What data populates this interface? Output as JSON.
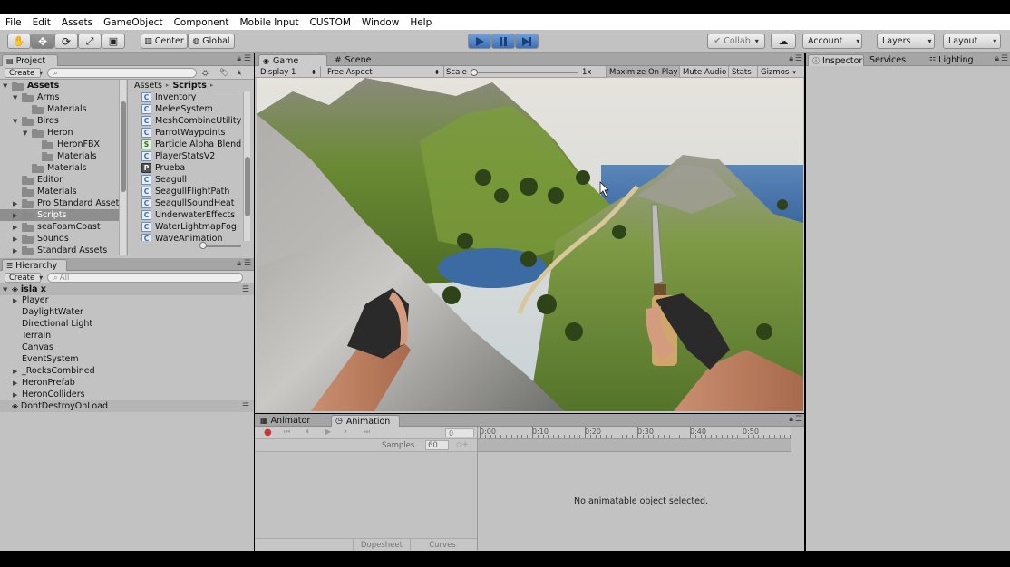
{
  "menubar": [
    "File",
    "Edit",
    "Assets",
    "GameObject",
    "Component",
    "Mobile Input",
    "CUSTOM",
    "Window",
    "Help"
  ],
  "toolbar": {
    "pivot": "Center",
    "space": "Global",
    "collab": "Collab",
    "account": "Account",
    "layers": "Layers",
    "layout": "Layout"
  },
  "project": {
    "tab": "Project",
    "create": "Create",
    "folders": [
      {
        "label": "Assets",
        "level": 0,
        "arrow": "▼",
        "bold": true
      },
      {
        "label": "Arms",
        "level": 1,
        "arrow": "▼"
      },
      {
        "label": "Materials",
        "level": 2,
        "arrow": ""
      },
      {
        "label": "Birds",
        "level": 1,
        "arrow": "▼"
      },
      {
        "label": "Heron",
        "level": 2,
        "arrow": "▼"
      },
      {
        "label": "HeronFBX",
        "level": 3,
        "arrow": ""
      },
      {
        "label": "Materials",
        "level": 3,
        "arrow": ""
      },
      {
        "label": "Materials",
        "level": 2,
        "arrow": ""
      },
      {
        "label": "Editor",
        "level": 1,
        "arrow": ""
      },
      {
        "label": "Materials",
        "level": 1,
        "arrow": ""
      },
      {
        "label": "Pro Standard Asset",
        "level": 1,
        "arrow": "▶"
      },
      {
        "label": "Scripts",
        "level": 1,
        "arrow": "▶",
        "selected": true
      },
      {
        "label": "seaFoamCoast",
        "level": 1,
        "arrow": "▶"
      },
      {
        "label": "Sounds",
        "level": 1,
        "arrow": "▶"
      },
      {
        "label": "Standard Assets",
        "level": 1,
        "arrow": "▶"
      }
    ],
    "breadcrumb": [
      "Assets",
      "Scripts"
    ],
    "files": [
      {
        "label": "Inventory",
        "icon": "C"
      },
      {
        "label": "MeleeSystem",
        "icon": "C"
      },
      {
        "label": "MeshCombineUtility",
        "icon": "C"
      },
      {
        "label": "ParrotWaypoints",
        "icon": "C"
      },
      {
        "label": "Particle Alpha Blend",
        "icon": "S"
      },
      {
        "label": "PlayerStatsV2",
        "icon": "C"
      },
      {
        "label": "Prueba",
        "icon": "P"
      },
      {
        "label": "Seagull",
        "icon": "C"
      },
      {
        "label": "SeagullFlightPath",
        "icon": "C"
      },
      {
        "label": "SeagullSoundHeat",
        "icon": "C"
      },
      {
        "label": "UnderwaterEffects",
        "icon": "C"
      },
      {
        "label": "WaterLightmapFog",
        "icon": "C"
      },
      {
        "label": "WaveAnimation",
        "icon": "C"
      }
    ]
  },
  "hierarchy": {
    "tab": "Hierarchy",
    "create": "Create",
    "search_placeholder": "All",
    "scene": "isla x",
    "items": [
      {
        "label": "Player",
        "arrow": "▶"
      },
      {
        "label": "DaylightWater",
        "arrow": ""
      },
      {
        "label": "Directional Light",
        "arrow": ""
      },
      {
        "label": "Terrain",
        "arrow": ""
      },
      {
        "label": "Canvas",
        "arrow": ""
      },
      {
        "label": "EventSystem",
        "arrow": ""
      },
      {
        "label": "_RocksCombined",
        "arrow": "▶"
      },
      {
        "label": "HeronPrefab",
        "arrow": "▶"
      },
      {
        "label": "HeronColliders",
        "arrow": "▶"
      }
    ],
    "dontdestroy": "DontDestroyOnLoad"
  },
  "game": {
    "tabs": [
      "Game",
      "Scene"
    ],
    "display": "Display 1",
    "aspect": "Free Aspect",
    "scale_label": "Scale",
    "scale_value": "1x",
    "toggles": [
      "Maximize On Play",
      "Mute Audio",
      "Stats",
      "Gizmos"
    ]
  },
  "animation": {
    "tabs": [
      "Animator",
      "Animation"
    ],
    "frame": "0",
    "samples_label": "Samples",
    "samples": "60",
    "ruler": [
      "0:00",
      "0:10",
      "0:20",
      "0:30",
      "0:40",
      "0:50"
    ],
    "empty_message": "No animatable object selected.",
    "bottom_tabs": [
      "Dopesheet",
      "Curves"
    ]
  },
  "inspector": {
    "tabs": [
      "Inspector",
      "Services",
      "Lighting"
    ]
  }
}
